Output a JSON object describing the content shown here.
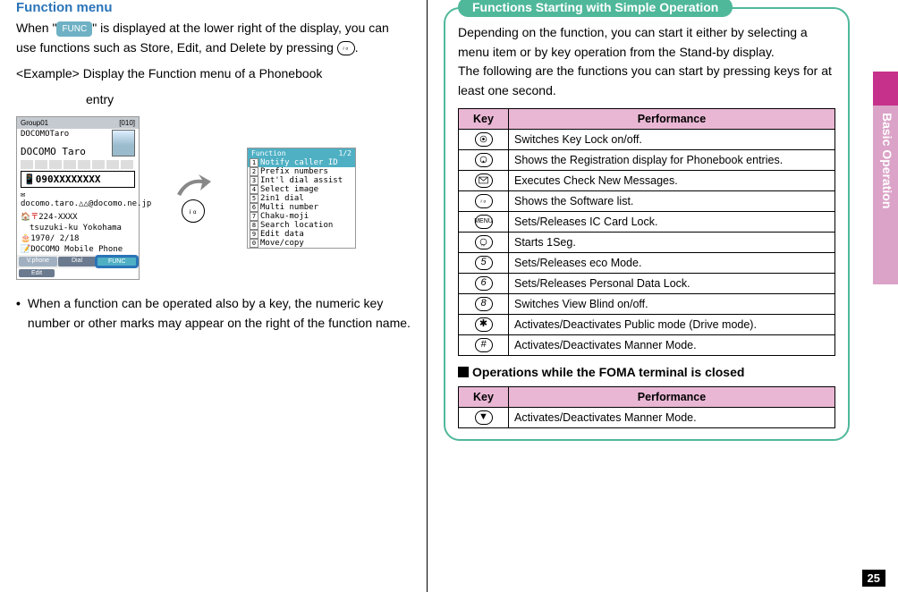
{
  "side_tab": "Basic Operation",
  "page_number": "25",
  "left": {
    "heading": "Function menu",
    "para1_a": "When \"",
    "func_badge": "FUNC",
    "para1_b": "\" is displayed at the lower right of the display, you can use functions such as Store, Edit, and Delete by pressing ",
    "para1_c": ".",
    "example_a": "<Example> Display the Function menu of a Phonebook",
    "example_b": "entry",
    "phone": {
      "group": "Group01",
      "count": "[010]",
      "name1": "DOCOMOTaro",
      "name2": "DOCOMO Taro",
      "number": "090XXXXXXXX",
      "email": "docomo.taro.△△@docomo.ne.jp",
      "postal": "224-XXXX",
      "addr": "tsuzuki-ku Yokohama",
      "bday": "1970/ 2/18",
      "memo": "DOCOMO Mobile Phone",
      "btn_vphone": "V.phone",
      "btn_edit": "Edit",
      "btn_dial": "Dial",
      "btn_func": "FUNC"
    },
    "funcmenu": {
      "title": "Function",
      "page": "1/2",
      "items": [
        {
          "n": "1",
          "label": "Notify caller ID"
        },
        {
          "n": "2",
          "label": "Prefix numbers"
        },
        {
          "n": "3",
          "label": "Int'l dial assist"
        },
        {
          "n": "4",
          "label": "Select image"
        },
        {
          "n": "5",
          "label": "2in1 dial"
        },
        {
          "n": "6",
          "label": "Multi number"
        },
        {
          "n": "7",
          "label": "Chaku-moji"
        },
        {
          "n": "8",
          "label": "Search location"
        },
        {
          "n": "9",
          "label": "Edit data"
        },
        {
          "n": "0",
          "label": "Move/copy"
        }
      ]
    },
    "bullet1": "When a function can be operated also by a key, the numeric key number or other marks may appear on the right of the function name."
  },
  "right": {
    "callout_title": "Functions Starting with Simple Operation",
    "callout_p1": "Depending on the function, you can start it either by selecting a menu item or by key operation from the Stand-by display.",
    "callout_p2": "The following are the functions you can start by pressing keys for at least one second.",
    "th_key": "Key",
    "th_perf": "Performance",
    "rows": [
      {
        "key": "center-dot",
        "perf": "Switches Key Lock on/off."
      },
      {
        "key": "down-ring",
        "perf": "Shows the Registration display for Phonebook entries."
      },
      {
        "key": "mail",
        "perf": "Executes Check New Messages."
      },
      {
        "key": "i-alpha",
        "perf": "Shows the Software list."
      },
      {
        "key": "menu",
        "perf": "Sets/Releases IC Card Lock."
      },
      {
        "key": "tv",
        "perf": "Starts 1Seg."
      },
      {
        "key": "5",
        "perf": "Sets/Releases eco Mode."
      },
      {
        "key": "6",
        "perf": "Sets/Releases Personal Data Lock."
      },
      {
        "key": "8",
        "perf": "Switches View Blind on/off."
      },
      {
        "key": "star",
        "perf": "Activates/Deactivates Public mode (Drive mode)."
      },
      {
        "key": "hash",
        "perf": "Activates/Deactivates Manner Mode."
      }
    ],
    "closed_heading": "Operations while the FOMA terminal is closed",
    "closed_rows": [
      {
        "key": "vol-down",
        "perf": "Activates/Deactivates Manner Mode."
      }
    ]
  }
}
